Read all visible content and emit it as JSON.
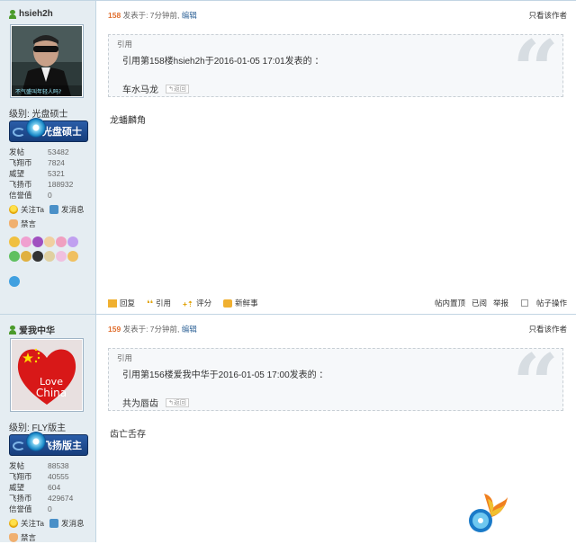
{
  "posts": [
    {
      "username": "hsieh2h",
      "avatar_caption": "不气盛叫年轻人吗?",
      "level": "级别: 光盘硕士",
      "badge": "光盘硕士",
      "stats": [
        {
          "k": "发帖",
          "v": "53482"
        },
        {
          "k": "飞翔币",
          "v": "7824"
        },
        {
          "k": "威望",
          "v": "5321"
        },
        {
          "k": "飞扬币",
          "v": "188932"
        },
        {
          "k": "信誉值",
          "v": "0"
        }
      ],
      "actions": {
        "follow": "关注Ta",
        "message": "发消息",
        "ban": "禁言"
      },
      "header": {
        "floor": "158",
        "posted": "发表于: 7分钟前",
        "sep": ",",
        "edit": "编辑",
        "only_author": "只看该作者"
      },
      "quote": {
        "title": "引用",
        "line": "引用第158楼hsieh2h于2016-01-05 17:01发表的 ：",
        "text": "车水马龙",
        "back": "↰返回"
      },
      "body": "龙蟠麟角",
      "footer": {
        "reply": "回复",
        "quote": "引用",
        "rate": "评分",
        "new": "新鲜事",
        "view": "帖内置顶",
        "read": "已阅",
        "report": "举报",
        "manage": "帖子操作"
      }
    },
    {
      "username": "爱我中华",
      "avatar_caption": "Love China",
      "level": "级别: FLY版主",
      "badge": "飞扬版主",
      "stats": [
        {
          "k": "发帖",
          "v": "88538"
        },
        {
          "k": "飞翔币",
          "v": "40555"
        },
        {
          "k": "威望",
          "v": "604"
        },
        {
          "k": "飞扬币",
          "v": "429674"
        },
        {
          "k": "信誉值",
          "v": "0"
        }
      ],
      "actions": {
        "follow": "关注Ta",
        "message": "发消息",
        "ban": "禁言"
      },
      "header": {
        "floor": "159",
        "posted": "发表于: 7分钟前",
        "sep": ",",
        "edit": "编辑",
        "only_author": "只看该作者"
      },
      "quote": {
        "title": "引用",
        "line": "引用第156楼爱我中华于2016-01-05 17:00发表的 ：",
        "text": "共为唇齿",
        "back": "↰返回"
      },
      "body": "齿亡舌存"
    }
  ],
  "colors": {
    "floor": "#e06e2e",
    "link": "#336699",
    "sidebar": "#e5edf2",
    "quote_bg": "#f6f8fa"
  }
}
